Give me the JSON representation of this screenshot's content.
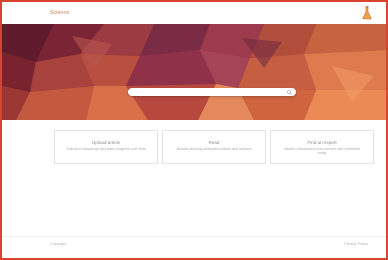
{
  "header": {
    "brand": "Science",
    "icon": "flask-icon"
  },
  "hero": {
    "colors": [
      "#7b1d1c",
      "#9a2a25",
      "#b8432e",
      "#d7653e",
      "#6f2f45",
      "#8d3b53",
      "#c85a38",
      "#e57b4d"
    ],
    "search": {
      "placeholder": "",
      "icon": "search-icon"
    }
  },
  "cards": [
    {
      "title": "Upload article",
      "description": "Submit a manuscript and track progress over time"
    },
    {
      "title": "Read",
      "description": "Browse recently published articles and reviews"
    },
    {
      "title": "Find an expert",
      "description": "Search researchers and connect with reviewers today"
    }
  ],
  "footer": {
    "left": "Copyright",
    "right": "Privacy Policy"
  }
}
